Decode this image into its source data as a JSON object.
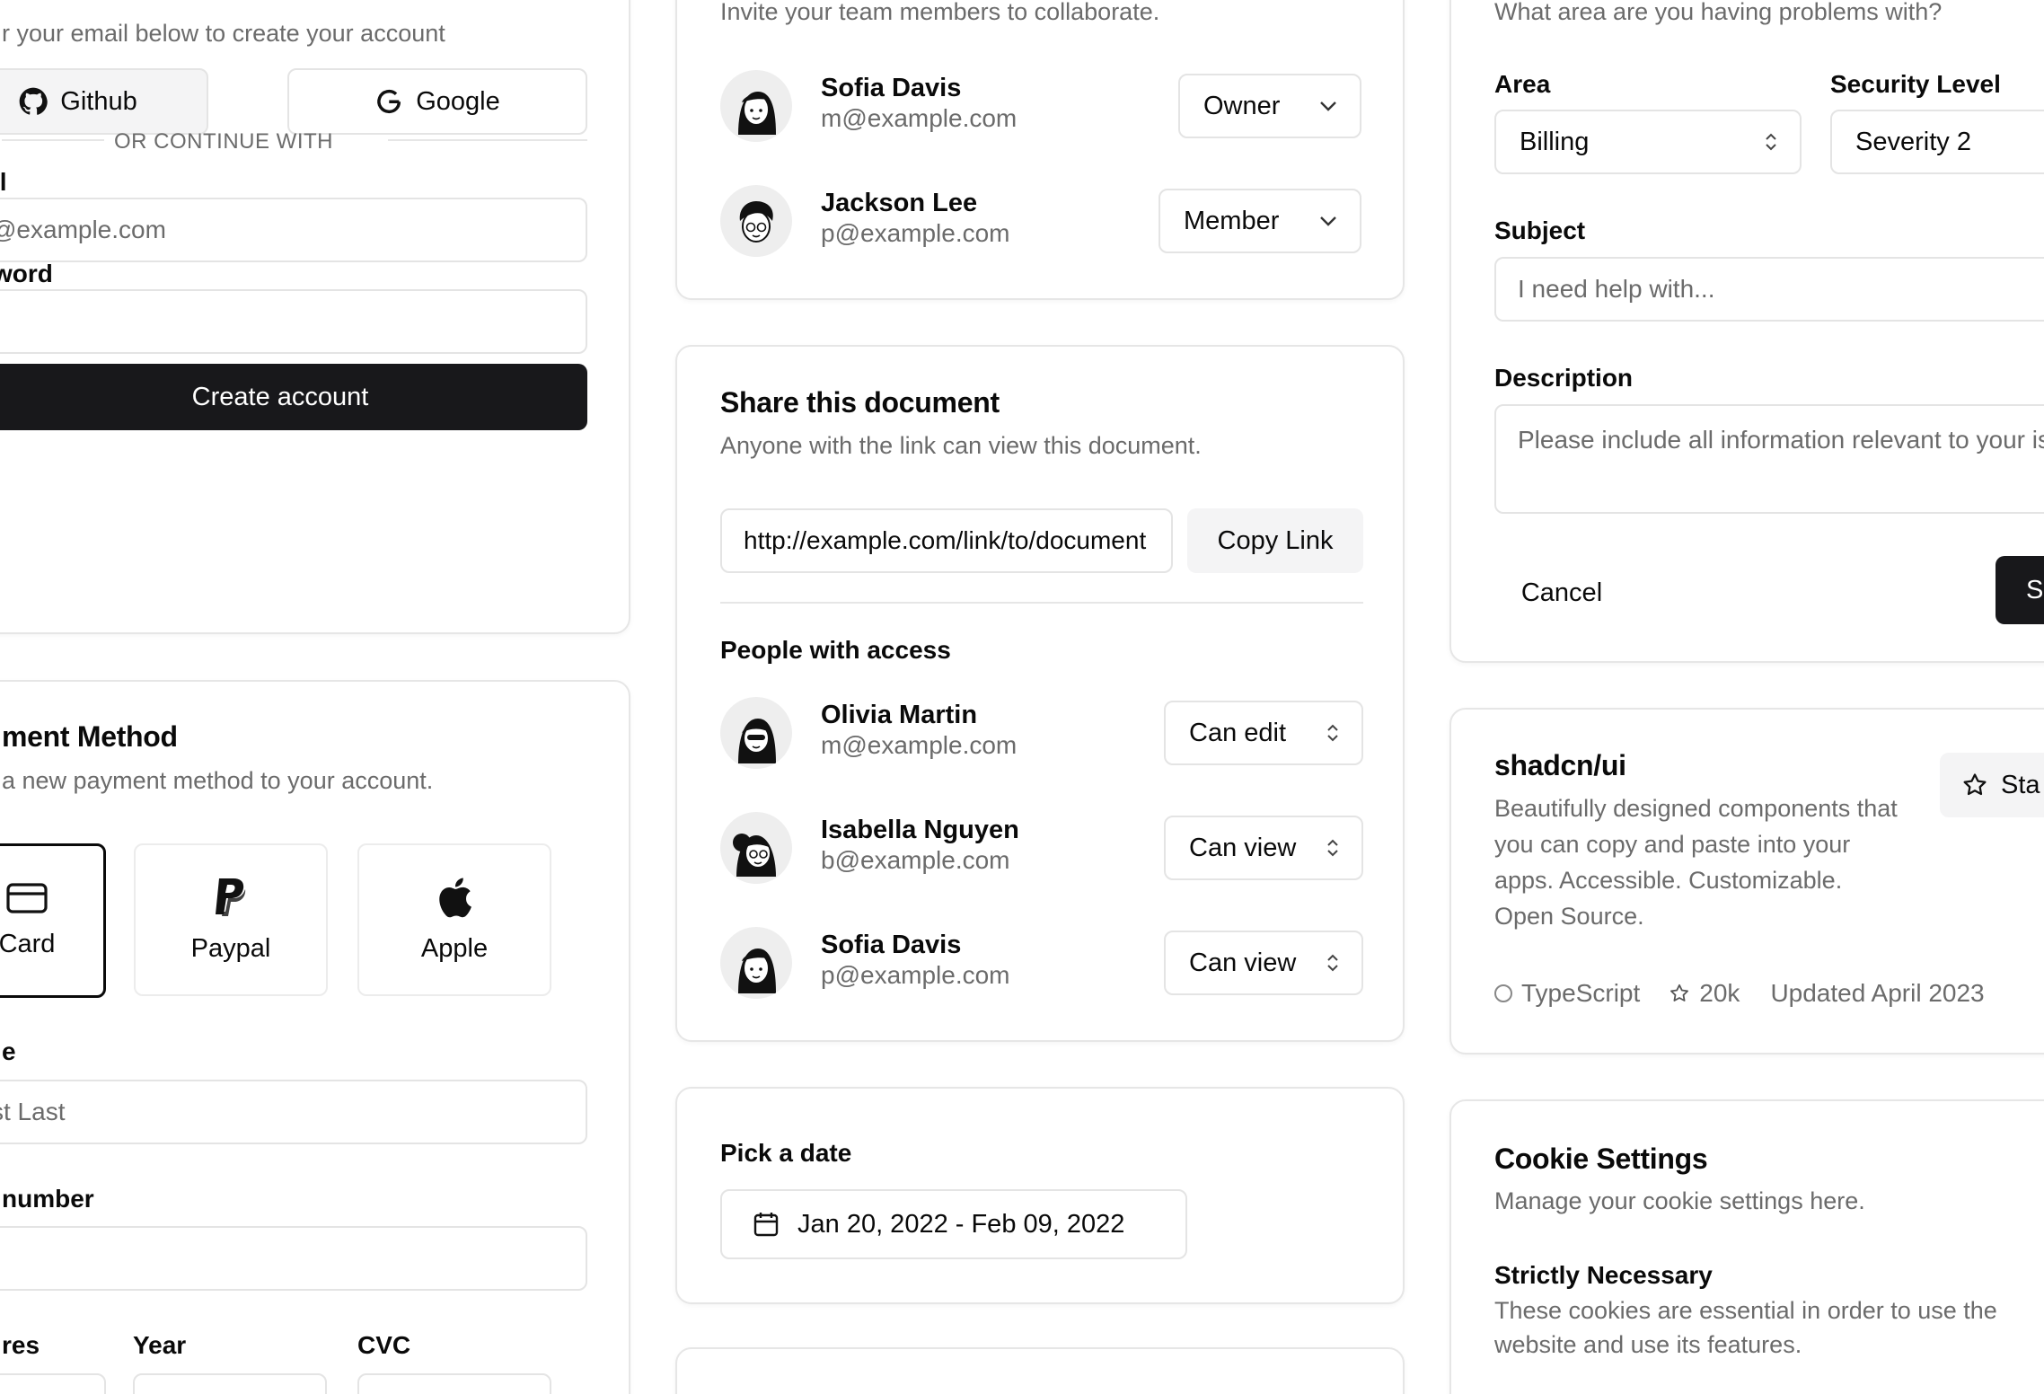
{
  "create_account": {
    "subtitle": "r your email below to create your account",
    "github_label": "Github",
    "google_label": "Google",
    "divider_text": "OR CONTINUE WITH",
    "email_label": "il",
    "email_placeholder": "@example.com",
    "password_label": "word",
    "submit_label": "Create account"
  },
  "payment": {
    "title": "ment Method",
    "subtitle": "a new payment method to your account.",
    "options": [
      {
        "label": "Card",
        "icon": "credit-card-icon"
      },
      {
        "label": "Paypal",
        "icon": "paypal-icon"
      },
      {
        "label": "Apple",
        "icon": "apple-icon"
      }
    ],
    "name_label": "e",
    "name_placeholder": "st Last",
    "card_number_label": " number",
    "expires_label": "res",
    "year_label": "Year",
    "cvc_label": "CVC"
  },
  "team": {
    "subtitle": "Invite your team members to collaborate.",
    "members": [
      {
        "name": "Sofia Davis",
        "email": "m@example.com",
        "role": "Owner"
      },
      {
        "name": "Jackson Lee",
        "email": "p@example.com",
        "role": "Member"
      }
    ]
  },
  "share": {
    "title": "Share this document",
    "subtitle": "Anyone with the link can view this document.",
    "link_value": "http://example.com/link/to/document",
    "copy_label": "Copy Link",
    "people_heading": "People with access",
    "people": [
      {
        "name": "Olivia Martin",
        "email": "m@example.com",
        "permission": "Can edit"
      },
      {
        "name": "Isabella Nguyen",
        "email": "b@example.com",
        "permission": "Can view"
      },
      {
        "name": "Sofia Davis",
        "email": "p@example.com",
        "permission": "Can view"
      }
    ]
  },
  "date_picker": {
    "label": "Pick a date",
    "value": "Jan 20, 2022 - Feb 09, 2022"
  },
  "support": {
    "subtitle": "What area are you having problems with?",
    "area_label": "Area",
    "area_value": "Billing",
    "security_label": "Security Level",
    "security_value": "Severity 2",
    "subject_label": "Subject",
    "subject_placeholder": "I need help with...",
    "description_label": "Description",
    "description_placeholder": "Please include all information relevant to your issue.",
    "cancel_label": "Cancel",
    "submit_label": "Su"
  },
  "repo": {
    "name": "shadcn/ui",
    "description": "Beautifully designed components that you can copy and paste into your apps. Accessible. Customizable. Open Source.",
    "star_label": "Sta",
    "language": "TypeScript",
    "stars": "20k",
    "updated": "Updated April 2023"
  },
  "cookies": {
    "title": "Cookie Settings",
    "subtitle": "Manage your cookie settings here.",
    "strict_title": "Strictly Necessary",
    "strict_desc": "These cookies are essential in order to use the website and use its features."
  },
  "colors": {
    "primary": "#18181b",
    "border": "#e4e4e4",
    "muted_text": "#6b6b6b"
  }
}
